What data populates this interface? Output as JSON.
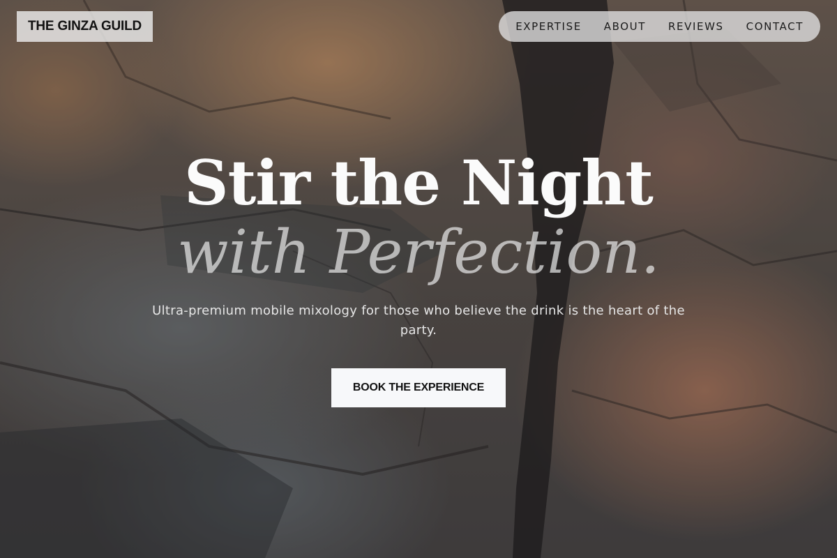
{
  "header": {
    "logo_text": "THE GINZA GUILD",
    "nav": [
      {
        "label": "EXPERTISE"
      },
      {
        "label": "ABOUT"
      },
      {
        "label": "REVIEWS"
      },
      {
        "label": "CONTACT"
      }
    ]
  },
  "hero": {
    "headline_line1": "Stir the Night",
    "headline_line2": "with Perfection.",
    "subtitle": "Ultra-premium mobile mixology for those who believe the drink is the heart of the party.",
    "cta_label": "BOOK THE EXPERIENCE",
    "background_image": "rocky-coastline-photo"
  }
}
